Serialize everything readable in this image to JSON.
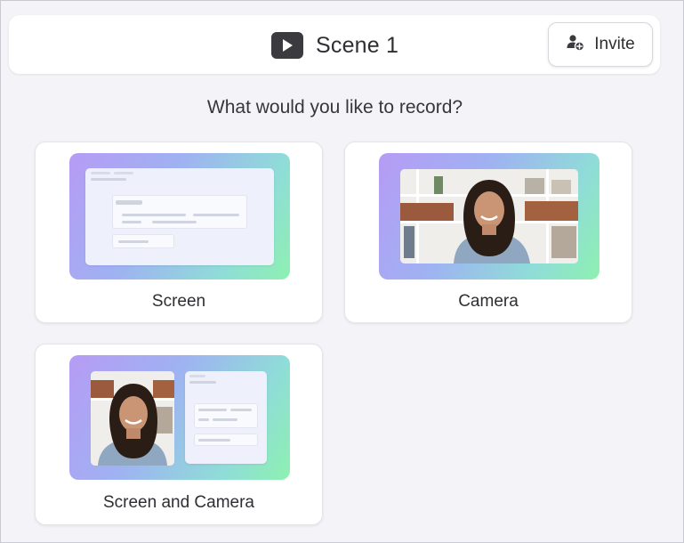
{
  "header": {
    "title": "Scene 1",
    "invite_label": "Invite"
  },
  "prompt": {
    "question": "What would you like to record?"
  },
  "options": [
    {
      "label": "Screen"
    },
    {
      "label": "Camera"
    },
    {
      "label": "Screen and Camera"
    }
  ],
  "colors": {
    "background": "#f4f4f8",
    "card": "#ffffff",
    "text": "#2e2e33",
    "play_icon_bg": "#3a3a3f",
    "gradient_start": "#b69bf5",
    "gradient_end": "#8ef1b0"
  },
  "icons": {
    "play": "play-icon",
    "invite": "add-user-icon"
  }
}
